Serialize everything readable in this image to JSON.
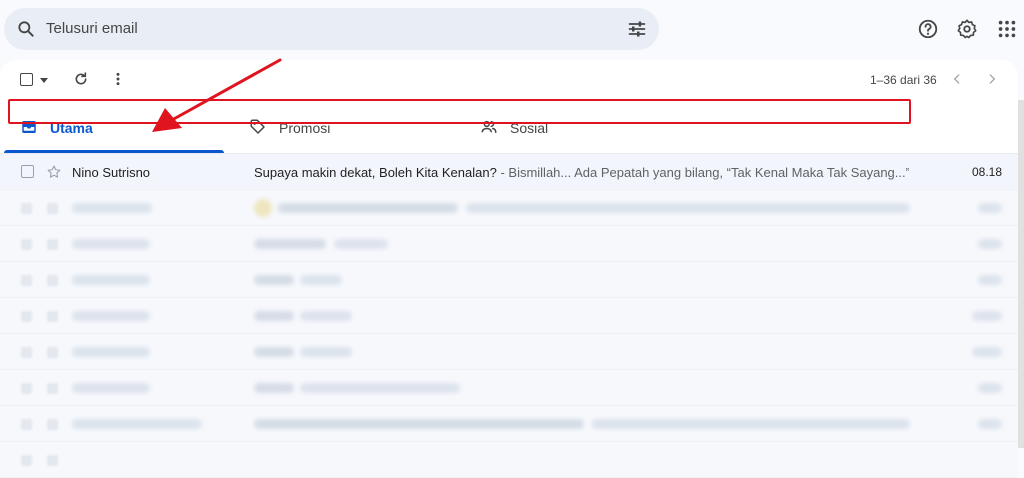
{
  "search": {
    "placeholder": "Telusuri email"
  },
  "toolbar": {
    "pager": "1–36 dari 36"
  },
  "tabs": [
    {
      "label": "Utama",
      "active": true
    },
    {
      "label": "Promosi",
      "active": false
    },
    {
      "label": "Sosial",
      "active": false
    }
  ],
  "emails": [
    {
      "sender": "Nino Sutrisno",
      "subject": "Supaya makin dekat, Boleh Kita Kenalan?",
      "snippet": " - Bismillah... Ada Pepatah yang bilang, “Tak Kenal Maka Tak Sayang...” ...",
      "time": "08.18"
    }
  ],
  "colors": {
    "accent": "#0b57d0",
    "highlight": "#e0141e",
    "search_bg": "#e9eef6"
  },
  "icons": [
    "search-icon",
    "filter-icon",
    "help-icon",
    "settings-icon",
    "apps-icon",
    "refresh-icon",
    "more-icon",
    "inbox-icon",
    "tag-icon",
    "people-icon",
    "star-icon"
  ]
}
